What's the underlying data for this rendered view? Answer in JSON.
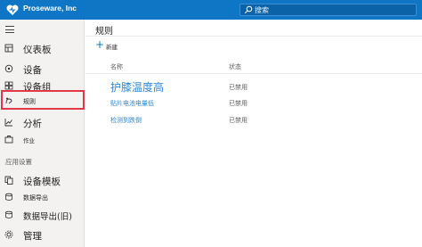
{
  "header": {
    "brand_name": "Proseware, Inc",
    "brand_icon": "heart-logo-icon",
    "search_placeholder": "搜索",
    "search_icon": "search-icon",
    "background_color": "#0f76c6"
  },
  "sidebar": {
    "menu_icon": "hamburger-icon",
    "items": [
      {
        "label": "仪表板",
        "icon": "dashboard-icon"
      },
      {
        "label": "设备",
        "icon": "devices-icon"
      },
      {
        "label": "设备组",
        "icon": "device-groups-icon"
      },
      {
        "label": "规则",
        "icon": "rules-icon",
        "selected": true
      },
      {
        "label": "分析",
        "icon": "analytics-icon"
      },
      {
        "label": "作业",
        "icon": "jobs-icon"
      }
    ],
    "section_header": "应用设置",
    "settings_items": [
      {
        "label": "设备模板",
        "icon": "device-templates-icon"
      },
      {
        "label": "数据导出",
        "icon": "data-export-icon"
      },
      {
        "label": "数据导出(旧)",
        "icon": "data-export-legacy-icon"
      },
      {
        "label": "管理",
        "icon": "administration-icon"
      }
    ],
    "selection_outline_color": "#e03a4a"
  },
  "main": {
    "title": "规则",
    "new_button": {
      "label": "新建",
      "icon": "plus-icon"
    },
    "columns": {
      "name": "名称",
      "status": "状态"
    },
    "rows": [
      {
        "name": "护膝温度高",
        "status": "已禁用"
      },
      {
        "name": "贴片电池电量低",
        "status": "已禁用"
      },
      {
        "name": "检测到跌倒",
        "status": "已禁用"
      }
    ],
    "link_color": "#2b88d8"
  }
}
